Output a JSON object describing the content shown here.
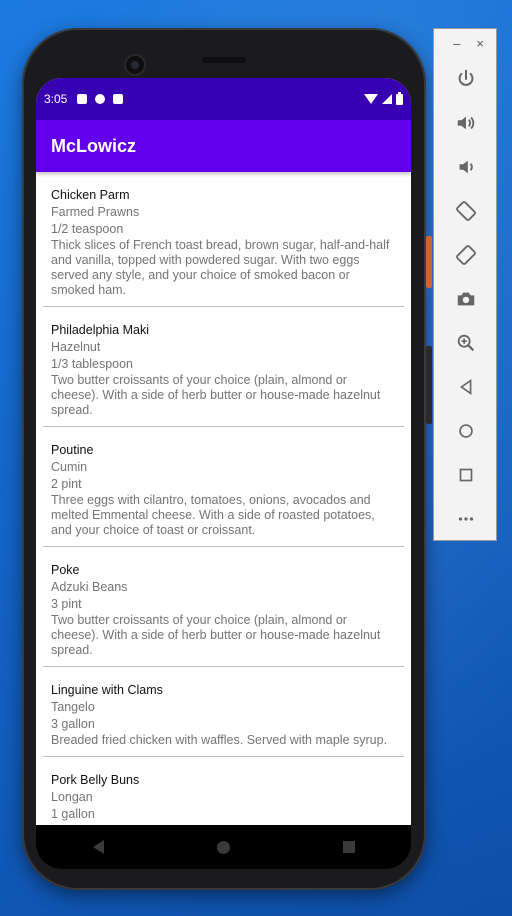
{
  "status_bar": {
    "time": "3:05"
  },
  "app_bar": {
    "title": "McLowicz"
  },
  "recipes": [
    {
      "name": "Chicken Parm",
      "ingredient": "Farmed Prawns",
      "measure": "1/2 teaspoon",
      "description": "Thick slices of French toast bread, brown sugar, half-and-half and vanilla, topped with powdered sugar. With two eggs served any style, and your choice of smoked bacon or smoked ham."
    },
    {
      "name": "Philadelphia Maki",
      "ingredient": "Hazelnut",
      "measure": "1/3 tablespoon",
      "description": "Two butter croissants of your choice (plain, almond or cheese). With a side of herb butter or house-made hazelnut spread."
    },
    {
      "name": "Poutine",
      "ingredient": "Cumin",
      "measure": "2 pint",
      "description": "Three eggs with cilantro, tomatoes, onions, avocados and melted Emmental cheese. With a side of roasted potatoes, and your choice of toast or croissant."
    },
    {
      "name": "Poke",
      "ingredient": "Adzuki Beans",
      "measure": "3 pint",
      "description": "Two butter croissants of your choice (plain, almond or cheese). With a side of herb butter or house-made hazelnut spread."
    },
    {
      "name": "Linguine with Clams",
      "ingredient": "Tangelo",
      "measure": "3 gallon",
      "description": "Breaded fried chicken with waffles. Served with maple syrup."
    },
    {
      "name": "Pork Belly Buns",
      "ingredient": "Longan",
      "measure": "1 gallon",
      "description": ""
    }
  ],
  "emulator_panel": {
    "minimize": "–",
    "close": "×",
    "controls": [
      "power-icon",
      "volume-up-icon",
      "volume-down-icon",
      "rotate-left-icon",
      "rotate-right-icon",
      "camera-icon",
      "zoom-icon",
      "back-icon",
      "home-icon",
      "overview-icon",
      "more-icon"
    ]
  },
  "colors": {
    "status_bar": "#3700b3",
    "app_bar": "#6200ee",
    "desktop": "#1565c9"
  }
}
